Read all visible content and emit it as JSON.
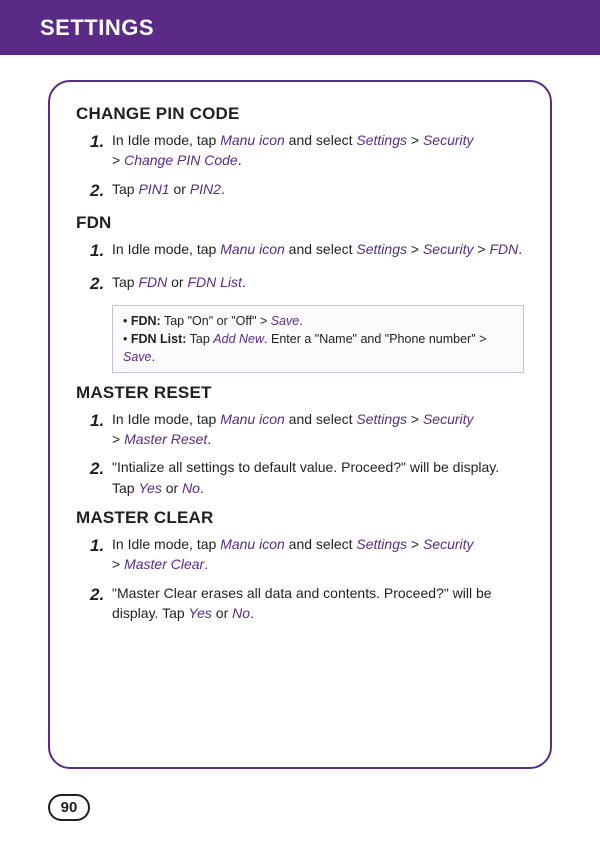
{
  "header": {
    "title": "SETTINGS"
  },
  "page_number": "90",
  "sections": {
    "change_pin": {
      "title": "CHANGE PIN CODE",
      "step1": {
        "num": "1.",
        "pre": "In Idle mode, tap ",
        "k1": "Manu icon",
        "mid1": " and select ",
        "k2": "Settings",
        "gt1": " > ",
        "k3": "Security",
        "br_gt": " > ",
        "k4": "Change PIN Code",
        "post": "."
      },
      "step2": {
        "num": "2.",
        "pre": "Tap ",
        "k1": "PIN1",
        "mid": " or ",
        "k2": "PIN2",
        "post": "."
      }
    },
    "fdn": {
      "title": "FDN",
      "step1": {
        "num": "1.",
        "pre": "In Idle mode, tap ",
        "k1": "Manu icon",
        "mid1": " and select ",
        "k2": "Settings",
        "gt1": " > ",
        "k3": "Security",
        "gt2": " > ",
        "k4": "FDN",
        "post": "."
      },
      "step2": {
        "num": "2.",
        "pre": "Tap ",
        "k1": "FDN",
        "mid": " or ",
        "k2": "FDN List",
        "post": "."
      },
      "note": {
        "row1": {
          "bullet": "• ",
          "label": "FDN:",
          "t1": " Tap \"On\" or \"Off\" > ",
          "k1": "Save",
          "t2": "."
        },
        "row2": {
          "bullet": "• ",
          "label": "FDN List:",
          "t1": " Tap ",
          "k1": "Add New",
          "t2": ". Enter a \"Name\" and \"Phone number\" > ",
          "k2": "Save",
          "t3": "."
        }
      }
    },
    "master_reset": {
      "title": "MASTER RESET",
      "step1": {
        "num": "1.",
        "pre": "In Idle mode, tap ",
        "k1": "Manu icon",
        "mid1": " and select ",
        "k2": "Settings",
        "gt1": " > ",
        "k3": "Security",
        "br_gt": " > ",
        "k4": "Master Reset",
        "post": "."
      },
      "step2": {
        "num": "2.",
        "t1": "\"Intialize all settings to default value. Proceed?\" will be display. Tap ",
        "k1": "Yes",
        "mid": " or ",
        "k2": "No",
        "post": "."
      }
    },
    "master_clear": {
      "title": "MASTER CLEAR",
      "step1": {
        "num": "1.",
        "pre": "In Idle mode, tap ",
        "k1": "Manu icon",
        "mid1": " and select ",
        "k2": "Settings",
        "gt1": " > ",
        "k3": "Security",
        "br_gt": " > ",
        "k4": "Master Clear",
        "post": "."
      },
      "step2": {
        "num": "2.",
        "t1": "\"Master Clear erases all data and contents. Proceed?\" will be display. Tap ",
        "k1": "Yes",
        "mid": " or ",
        "k2": "No",
        "post": "."
      }
    }
  }
}
